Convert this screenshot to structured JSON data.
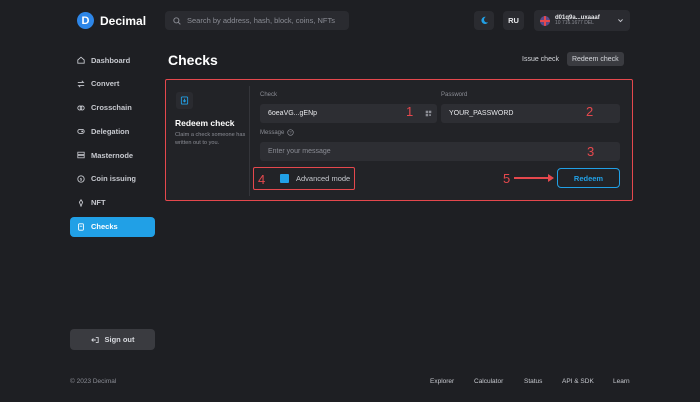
{
  "header": {
    "brand": "Decimal",
    "search_placeholder": "Search by address, hash, block, coins, NFTs",
    "language": "RU",
    "account_address": "d01q9a...uxaaaf",
    "account_balance": "10 716.1677 DEL"
  },
  "sidebar": {
    "items": [
      {
        "label": "Dashboard",
        "icon": "home-icon"
      },
      {
        "label": "Convert",
        "icon": "convert-icon"
      },
      {
        "label": "Crosschain",
        "icon": "crosschain-icon"
      },
      {
        "label": "Delegation",
        "icon": "delegation-icon"
      },
      {
        "label": "Masternode",
        "icon": "masternode-icon"
      },
      {
        "label": "Coin issuing",
        "icon": "coin-icon"
      },
      {
        "label": "NFT",
        "icon": "nft-icon"
      },
      {
        "label": "Checks",
        "icon": "checks-icon",
        "active": true
      }
    ],
    "sign_out": "Sign out"
  },
  "page": {
    "title": "Checks",
    "tabs": [
      {
        "label": "Issue check",
        "active": false
      },
      {
        "label": "Redeem check",
        "active": true
      }
    ]
  },
  "card": {
    "title": "Redeem check",
    "description": "Claim a check someone has written out to you.",
    "check_label": "Check",
    "check_value": "6oeaVG...gENp",
    "password_label": "Password",
    "password_value": "YOUR_PASSWORD",
    "message_label": "Message",
    "message_placeholder": "Enter your message",
    "advanced_mode_label": "Advanced mode",
    "advanced_mode_checked": true,
    "redeem_label": "Redeem"
  },
  "annotations": {
    "n1": "1",
    "n2": "2",
    "n3": "3",
    "n4": "4",
    "n5": "5"
  },
  "footer": {
    "copyright": "© 2023 Decimal",
    "links": [
      "Explorer",
      "Calculator",
      "Status",
      "API & SDK",
      "Learn"
    ]
  },
  "colors": {
    "accent": "#21a0e6",
    "annotation": "#e5484d",
    "background": "#1e1f23"
  }
}
